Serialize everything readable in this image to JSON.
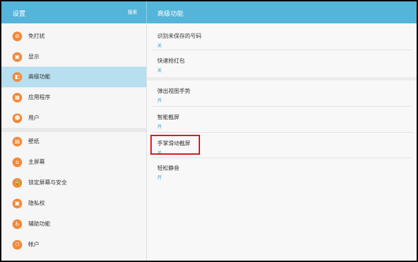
{
  "header": {
    "title_left": "设置",
    "search_label": "搜索",
    "title_right": "高级功能"
  },
  "sidebar": {
    "items": [
      {
        "label": "免打扰",
        "icon": "do-not-disturb-icon",
        "glyph": "⊖"
      },
      {
        "label": "显示",
        "icon": "display-icon",
        "glyph": "▣"
      },
      {
        "label": "高级功能",
        "icon": "advanced-features-icon",
        "glyph": "◧",
        "selected": true
      },
      {
        "label": "应用程序",
        "icon": "apps-icon",
        "glyph": "▦"
      },
      {
        "label": "用户",
        "icon": "users-icon",
        "glyph": "☻"
      },
      {
        "label": "壁纸",
        "icon": "wallpaper-icon",
        "glyph": "▤"
      },
      {
        "label": "主屏幕",
        "icon": "home-screen-icon",
        "glyph": "⌂"
      },
      {
        "label": "锁定屏幕与安全",
        "icon": "lock-icon",
        "glyph": "🔒"
      },
      {
        "label": "隐私权",
        "icon": "privacy-icon",
        "glyph": "▣"
      },
      {
        "label": "辅助功能",
        "icon": "accessibility-icon",
        "glyph": "♿"
      },
      {
        "label": "帐户",
        "icon": "account-icon",
        "glyph": "⚇"
      }
    ]
  },
  "main": {
    "options": [
      {
        "title": "识别未保存的号码",
        "status": "关"
      },
      {
        "title": "快速抢红包",
        "status": "关"
      },
      {
        "title": "弹出视图手势",
        "status": "开"
      },
      {
        "title": "智能截屏",
        "status": "开"
      },
      {
        "title": "手掌滑动截屏",
        "status": "关"
      },
      {
        "title": "轻松静音",
        "status": "开"
      }
    ]
  },
  "colors": {
    "header": "#55b4d9",
    "selected": "#b7dff0",
    "icon": "#f28a3b",
    "status": "#3aa2cc",
    "highlight_box": "#e0161b"
  }
}
